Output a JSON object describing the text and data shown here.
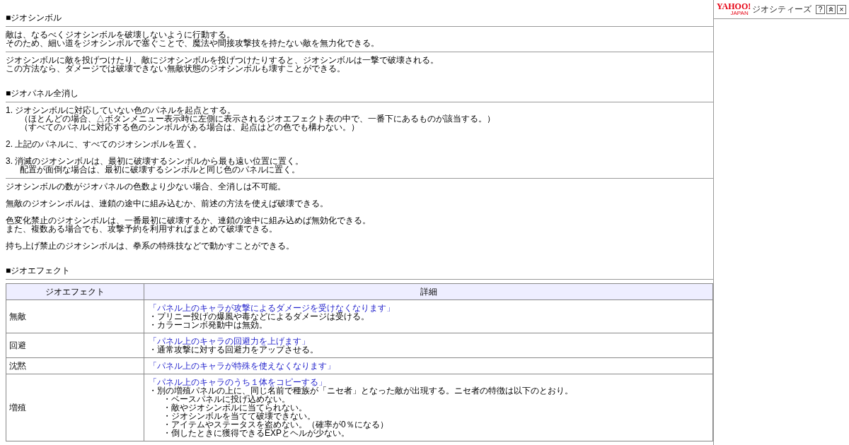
{
  "sections": [
    {
      "heading": "■ジオシンボル",
      "blocks": [
        {
          "paragraphs": [
            [
              {
                "text": "敵は、なるべくジオシンボルを破壊しないように行動する。"
              },
              {
                "text": "そのため、細い道をジオシンボルで塞ぐことで、魔法や間接攻撃技を持たない敵を無力化できる。"
              }
            ]
          ]
        },
        {
          "paragraphs": [
            [
              {
                "text": "ジオシンボルに敵を投げつけたり、敵にジオシンボルを投げつけたりすると、ジオシンボルは一撃で破壊される。"
              },
              {
                "text": "この方法なら、ダメージでは破壊できない無敵状態のジオシンボルも壊すことができる。"
              }
            ]
          ]
        }
      ]
    },
    {
      "heading": "■ジオパネル全消し",
      "blocks": [
        {
          "paragraphs": [
            [
              {
                "text": "1. ジオシンボルに対応していない色のパネルを起点とする。",
                "children": [
                  {
                    "text": "（ほとんどの場合、△ボタンメニュー表示時に左側に表示されるジオエフェクト表の中で、一番下にあるものが該当する。）"
                  },
                  {
                    "text": "（すべてのパネルに対応する色のシンボルがある場合は、起点はどの色でも構わない。）"
                  }
                ]
              }
            ],
            [
              {
                "text": "2. 上記のパネルに、すべてのジオシンボルを置く。"
              }
            ],
            [
              {
                "text": "3. 消滅のジオシンボルは、最初に破壊するシンボルから最も遠い位置に置く。",
                "children": [
                  {
                    "text": "配置が面倒な場合は、最初に破壊するシンボルと同じ色のパネルに置く。"
                  }
                ]
              }
            ]
          ]
        },
        {
          "paragraphs": [
            [
              {
                "text": "ジオシンボルの数がジオパネルの色数より少ない場合、全消しは不可能。"
              }
            ],
            [
              {
                "text": "無敵のジオシンボルは、連鎖の途中に組み込むか、前述の方法を使えば破壊できる。"
              }
            ],
            [
              {
                "text": "色変化禁止のジオシンボルは、一番最初に破壊するか、連鎖の途中に組み込めば無効化できる。"
              },
              {
                "text": "また、複数ある場合でも、攻撃予約を利用すればまとめて破壊できる。"
              }
            ],
            [
              {
                "text": "持ち上げ禁止のジオシンボルは、拳系の特殊技などで動かすことができる。"
              }
            ]
          ]
        }
      ]
    },
    {
      "heading": "■ジオエフェクト",
      "table": {
        "columns": [
          "ジオエフェクト",
          "詳細"
        ],
        "rows": [
          {
            "name": "無敵",
            "lead": "「パネル上のキャラが攻撃によるダメージを受けなくなります」",
            "notes": [
              {
                "text": "・プリニー投げの爆風や毒などによるダメージは受ける。"
              },
              {
                "text": "・カラーコンボ発動中は無効。"
              }
            ]
          },
          {
            "name": "回避",
            "lead": "「パネル上のキャラの回避力を上げます」",
            "notes": [
              {
                "text": "・通常攻撃に対する回避力をアップさせる。"
              }
            ]
          },
          {
            "name": "沈黙",
            "lead": "「パネル上のキャラが特殊を使えなくなります」",
            "notes": []
          },
          {
            "name": "増殖",
            "lead": "「パネル上のキャラのうち１体をコピーする」",
            "notes": [
              {
                "text": "・別の増殖パネルの上に、同じ名前で種族が「ニセ者」となった敵が出現する。ニセ者の特徴は以下のとおり。",
                "children": [
                  {
                    "text": "・ベースパネルに投げ込めない。"
                  },
                  {
                    "text": "・敵やジオシンボルに当てられない。"
                  },
                  {
                    "text": "・ジオシンボルを当てて破壊できない。"
                  },
                  {
                    "text": "・アイテムやステータスを盗めない。（確率が0％になる）"
                  },
                  {
                    "text": "・倒したときに獲得できるEXPとヘルが少ない。"
                  }
                ]
              }
            ]
          }
        ]
      }
    }
  ],
  "sidebar": {
    "logo": "YAHOO!",
    "logo_sub": "JAPAN",
    "service": "ジオシティーズ",
    "buttons": [
      {
        "kind": "text",
        "label": "?"
      },
      {
        "kind": "icon"
      },
      {
        "kind": "text",
        "label": "×"
      }
    ]
  }
}
